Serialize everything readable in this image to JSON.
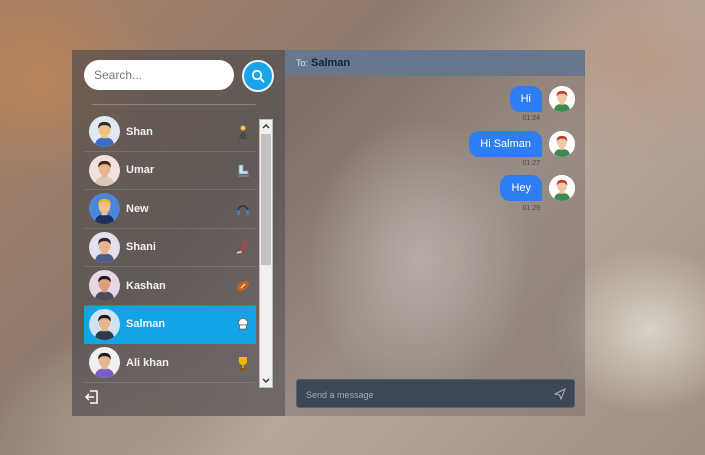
{
  "search": {
    "placeholder": "Search..."
  },
  "contacts": [
    {
      "name": "Shan",
      "status_icon": "person-icon",
      "skin": "#f1c27d",
      "hair": "#2b2b2b",
      "shirt": "#3b6fc4",
      "bg": "#dfe8f3"
    },
    {
      "name": "Umar",
      "status_icon": "ice-skate-icon",
      "skin": "#e8b48c",
      "hair": "#4a2a1a",
      "shirt": "#d8c9b8",
      "bg": "#f3e1e1"
    },
    {
      "name": "New",
      "status_icon": "headphones-icon",
      "skin": "#f0c08a",
      "hair": "#f3b42a",
      "shirt": "#1d2f5e",
      "bg": "#4a86d9"
    },
    {
      "name": "Shani",
      "status_icon": "hockey-stick-icon",
      "skin": "#e8b48c",
      "hair": "#2b2b2b",
      "shirt": "#4b5e8a",
      "bg": "#e3e0ec"
    },
    {
      "name": "Kashan",
      "status_icon": "football-icon",
      "skin": "#d9a07a",
      "hair": "#1a1a1a",
      "shirt": "#4b4b5a",
      "bg": "#e8d6e6"
    },
    {
      "name": "Salman",
      "status_icon": "chef-hat-icon",
      "skin": "#e8b48c",
      "hair": "#1a1a1a",
      "shirt": "#2c3a4a",
      "bg": "#cfe3f5",
      "selected": true
    },
    {
      "name": "Ali khan",
      "status_icon": "trophy-icon",
      "skin": "#e8b48c",
      "hair": "#1a1a1a",
      "shirt": "#7a5cc8",
      "bg": "#f0f0f0"
    }
  ],
  "chat": {
    "to_label": "To:",
    "to_name": "Salman",
    "messages": [
      {
        "text": "Hi",
        "time": "01:24"
      },
      {
        "text": "Hi Salman",
        "time": "01:27"
      },
      {
        "text": "Hey",
        "time": "01:29"
      }
    ],
    "input_placeholder": "Send a message"
  },
  "colors": {
    "accent": "#13a3e6",
    "bubble": "#2f7ef1",
    "header": "#67788e"
  }
}
